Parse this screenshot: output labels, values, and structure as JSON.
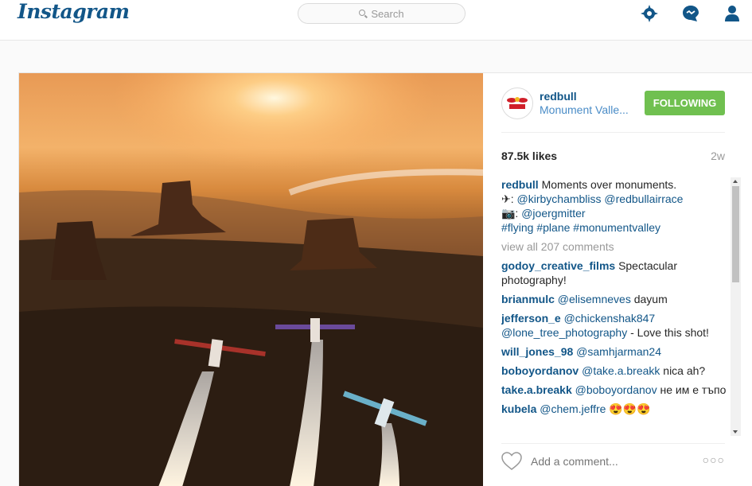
{
  "topbar": {
    "logo": "Instagram",
    "search_placeholder": "Search",
    "icons": [
      "explore-icon",
      "activity-icon",
      "profile-icon"
    ]
  },
  "post": {
    "owner": "redbull",
    "location": "Monument Valle...",
    "follow_label": "FOLLOWING",
    "likes": "87.5k likes",
    "time": "2w",
    "caption": {
      "user": "redbull",
      "text": "Moments over monuments.",
      "line2_prefix": "✈: ",
      "line2_a": "@kirbychambliss",
      "line2_b": "@redbullairrace",
      "line3_prefix": "📷: ",
      "line3_a": "@joergmitter",
      "tags": "#flying #plane #monumentvalley"
    },
    "view_all": "view all 207 comments",
    "comments": [
      {
        "user": "godoy_creative_films",
        "mention": "",
        "text": "Spectacular photography!"
      },
      {
        "user": "brianmulc",
        "mention": "@elisemneves",
        "text": "dayum"
      },
      {
        "user": "jefferson_e",
        "mention": "@chickenshak847 @lone_tree_photography",
        "text": "- Love this shot!"
      },
      {
        "user": "will_jones_98",
        "mention": "@samhjarman24",
        "text": ""
      },
      {
        "user": "boboyordanov",
        "mention": "@take.a.breakk",
        "text": "nica ah?"
      },
      {
        "user": "take.a.breakk",
        "mention": "@boboyordanov",
        "text": "не им е тъпо"
      },
      {
        "user": "kubela",
        "mention": "@chem.jeffre",
        "text": "😍😍😍"
      }
    ],
    "add_comment_placeholder": "Add a comment...",
    "more_label": "○○○"
  },
  "colors": {
    "brand_blue": "#125688",
    "follow_green": "#70c050"
  }
}
